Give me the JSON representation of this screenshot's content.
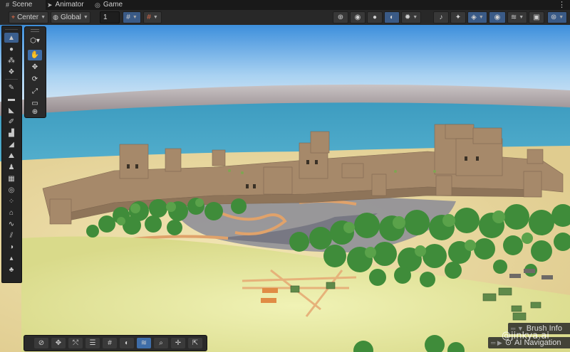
{
  "tabs": [
    {
      "label": "Scene",
      "icon": "grid-icon",
      "active": true
    },
    {
      "label": "Animator",
      "icon": "animator-icon",
      "active": false
    },
    {
      "label": "Game",
      "icon": "gamepad-icon",
      "active": false
    }
  ],
  "toolbar": {
    "pivot_mode": "Center",
    "pivot_rotation": "Global",
    "grid_increment": "1",
    "right_icons": [
      "gizmo-globe-icon",
      "shading-icon",
      "lighting-icon",
      "scene-view-icon",
      "effects-icon",
      "audio-mute-icon",
      "visibility-icon",
      "layers-icon",
      "camera-icon"
    ]
  },
  "sidebar": {
    "icons": [
      "terrain-icon",
      "sphere-icon",
      "scatter-icon",
      "prefab-icon",
      "paint-icon",
      "flatten-icon",
      "slope-icon",
      "pencil-icon",
      "stairs-icon",
      "ramp-icon",
      "mountain-icon",
      "road-icon",
      "person-icon",
      "grid-icon",
      "swirl-icon",
      "spray-icon",
      "stamp-icon",
      "wave-icon",
      "contrast-icon",
      "peak-icon",
      "tree-icon",
      "rock-icon"
    ]
  },
  "tools": {
    "items": [
      {
        "name": "hand-tool-icon",
        "glyph": "✋",
        "active": true
      },
      {
        "name": "move-tool-icon",
        "glyph": "✥",
        "active": false
      },
      {
        "name": "rotate-tool-icon",
        "glyph": "⟳",
        "active": false
      },
      {
        "name": "scale-tool-icon",
        "glyph": "⤢",
        "active": false
      },
      {
        "name": "rect-tool-icon",
        "glyph": "▭",
        "active": false
      },
      {
        "name": "transform-tool-icon",
        "glyph": "⊕",
        "active": false
      }
    ]
  },
  "bottom_toolbar": {
    "items": [
      "compass-icon",
      "move-icon",
      "pin-icon",
      "settings-sliders-icon",
      "grid-snap-icon",
      "moon-icon",
      "layers-icon",
      "magnify-icon",
      "pan-icon",
      "export-icon"
    ]
  },
  "overlays": {
    "brush_info": "Brush Info",
    "ai_navigation": "AI Navigation"
  },
  "watermark": "@jinkya.ai",
  "colors": {
    "accent": "#3e6da8",
    "panel": "#282828",
    "sea": "#4aa7c6",
    "sand": "#e8d7a0",
    "wall": "#a6896a",
    "tree": "#3f8c3a"
  }
}
